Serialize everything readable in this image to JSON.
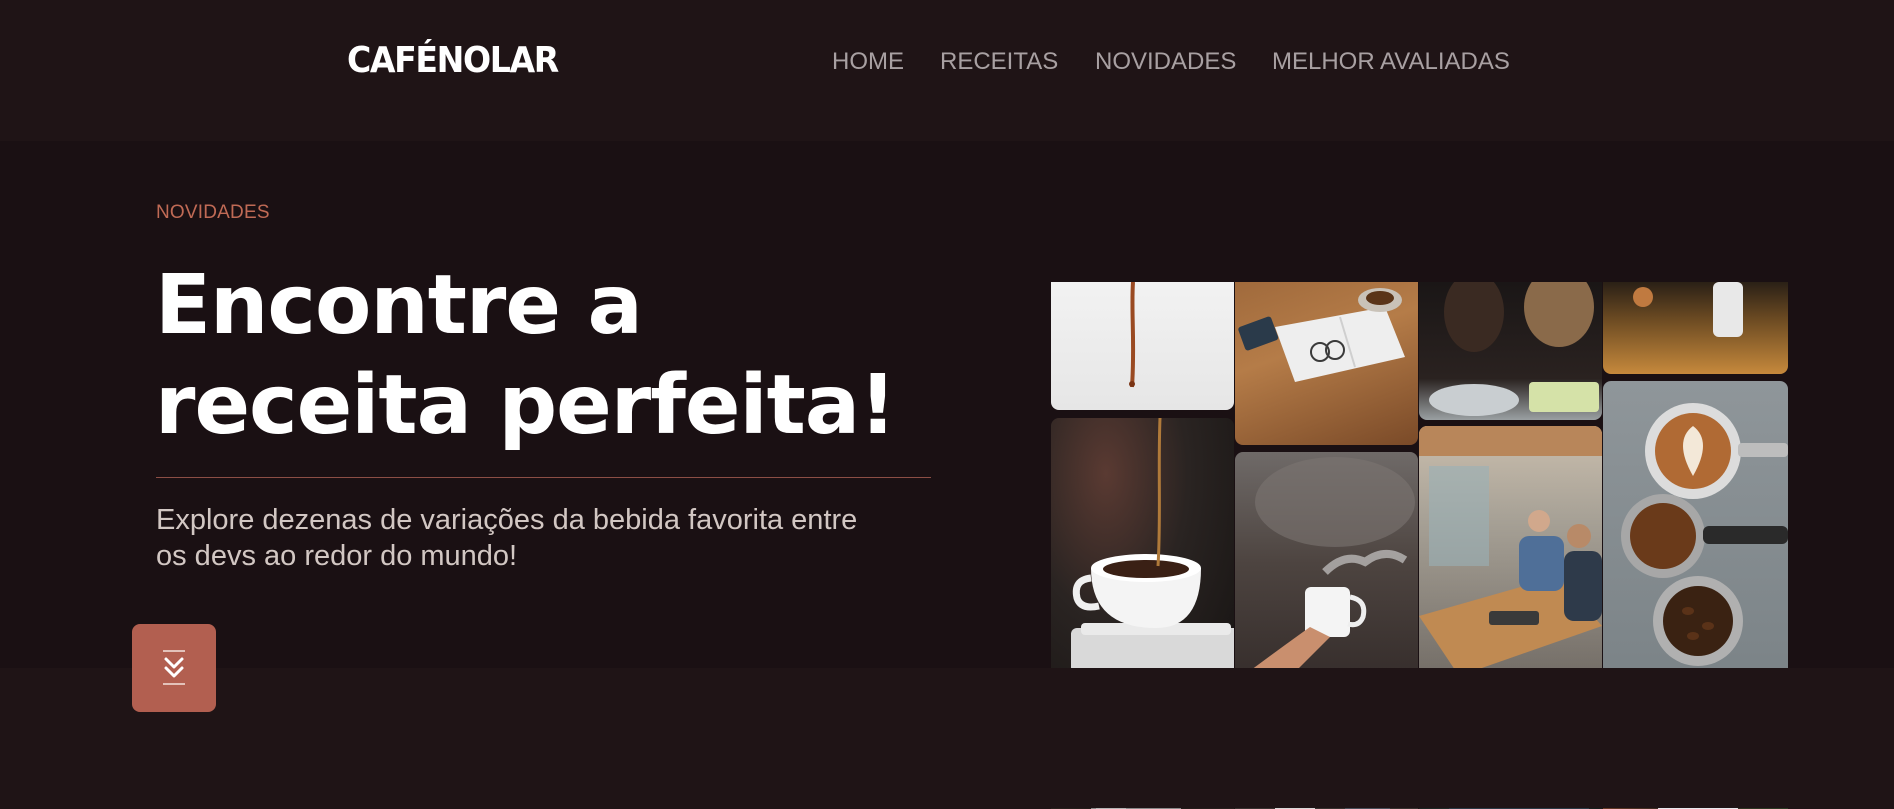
{
  "header": {
    "logo": "CAFÉNOLAR",
    "nav": [
      {
        "label": "HOME"
      },
      {
        "label": "RECEITAS"
      },
      {
        "label": "NOVIDADES"
      },
      {
        "label": "MELHOR AVALIADAS"
      }
    ]
  },
  "hero": {
    "eyebrow": "NOVIDADES",
    "title_line1": "Encontre a",
    "title_line2": "receita perfeita!",
    "description_line1": "Explore dezenas de variações da bebida favorita entre",
    "description_line2": "os devs ao redor do mundo!",
    "scroll_icon": "double-chevron-down-icon"
  },
  "gallery": {
    "photos": [
      {
        "name": "coffee-pouring-photo"
      },
      {
        "name": "desk-notebook-photo"
      },
      {
        "name": "people-lunch-photo"
      },
      {
        "name": "barista-counter-photo"
      },
      {
        "name": "coffee-cup-pour-photo"
      },
      {
        "name": "hand-holding-cup-photo"
      },
      {
        "name": "office-team-photo"
      },
      {
        "name": "latte-beans-photo"
      },
      {
        "name": "milk-pitcher-photo"
      },
      {
        "name": "cafe-people-photo"
      },
      {
        "name": "dark-cafe-photo"
      },
      {
        "name": "smiling-man-photo"
      }
    ]
  },
  "colors": {
    "background": "#1f1416",
    "hero_background": "#1a1013",
    "accent": "#c06a55",
    "button": "#b25f50",
    "nav_text": "#a8a0a2"
  }
}
